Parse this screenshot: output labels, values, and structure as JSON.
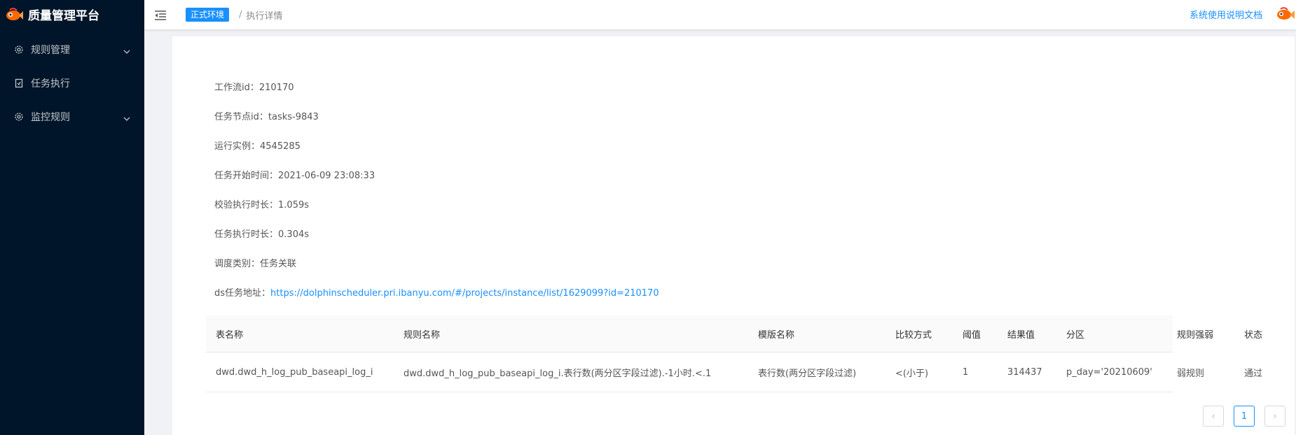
{
  "app": {
    "title": "质量管理平台"
  },
  "sidebar": {
    "items": [
      {
        "label": "规则管理",
        "icon": "gear-icon",
        "has_submenu": true
      },
      {
        "label": "任务执行",
        "icon": "task-icon",
        "has_submenu": false
      },
      {
        "label": "监控规则",
        "icon": "gear-icon",
        "has_submenu": true
      }
    ]
  },
  "header": {
    "env_tag": "正式环境",
    "separator": "/",
    "breadcrumb": "执行详情",
    "doc_link": "系统使用说明文档"
  },
  "details": [
    {
      "label": "工作流id：",
      "value": "210170"
    },
    {
      "label": "任务节点id：",
      "value": "tasks-9843"
    },
    {
      "label": "运行实例：",
      "value": "4545285"
    },
    {
      "label": "任务开始时间：",
      "value": "2021-06-09 23:08:33"
    },
    {
      "label": "校验执行时长：",
      "value": "1.059s"
    },
    {
      "label": "任务执行时长：",
      "value": "0.304s"
    },
    {
      "label": "调度类别：",
      "value": "任务关联"
    }
  ],
  "ds_link": {
    "label": "ds任务地址：",
    "url": "https://dolphinscheduler.pri.ibanyu.com/#/projects/instance/list/1629099?id=210170"
  },
  "table": {
    "columns": [
      "表名称",
      "规则名称",
      "模版名称",
      "比较方式",
      "阈值",
      "结果值",
      "分区",
      "规则强弱",
      "状态"
    ],
    "rows": [
      [
        "dwd.dwd_h_log_pub_baseapi_log_i",
        "dwd.dwd_h_log_pub_baseapi_log_i.表行数(两分区字段过滤).-1小时.<.1",
        "表行数(两分区字段过滤)",
        "<(小于)",
        "1",
        "314437",
        "p_day='20210609'",
        "弱规则",
        "通过"
      ]
    ]
  },
  "pagination": {
    "current": "1",
    "prev": "‹",
    "next": "›"
  },
  "colors": {
    "sidebar_bg": "#001529",
    "accent": "#1890ff"
  }
}
